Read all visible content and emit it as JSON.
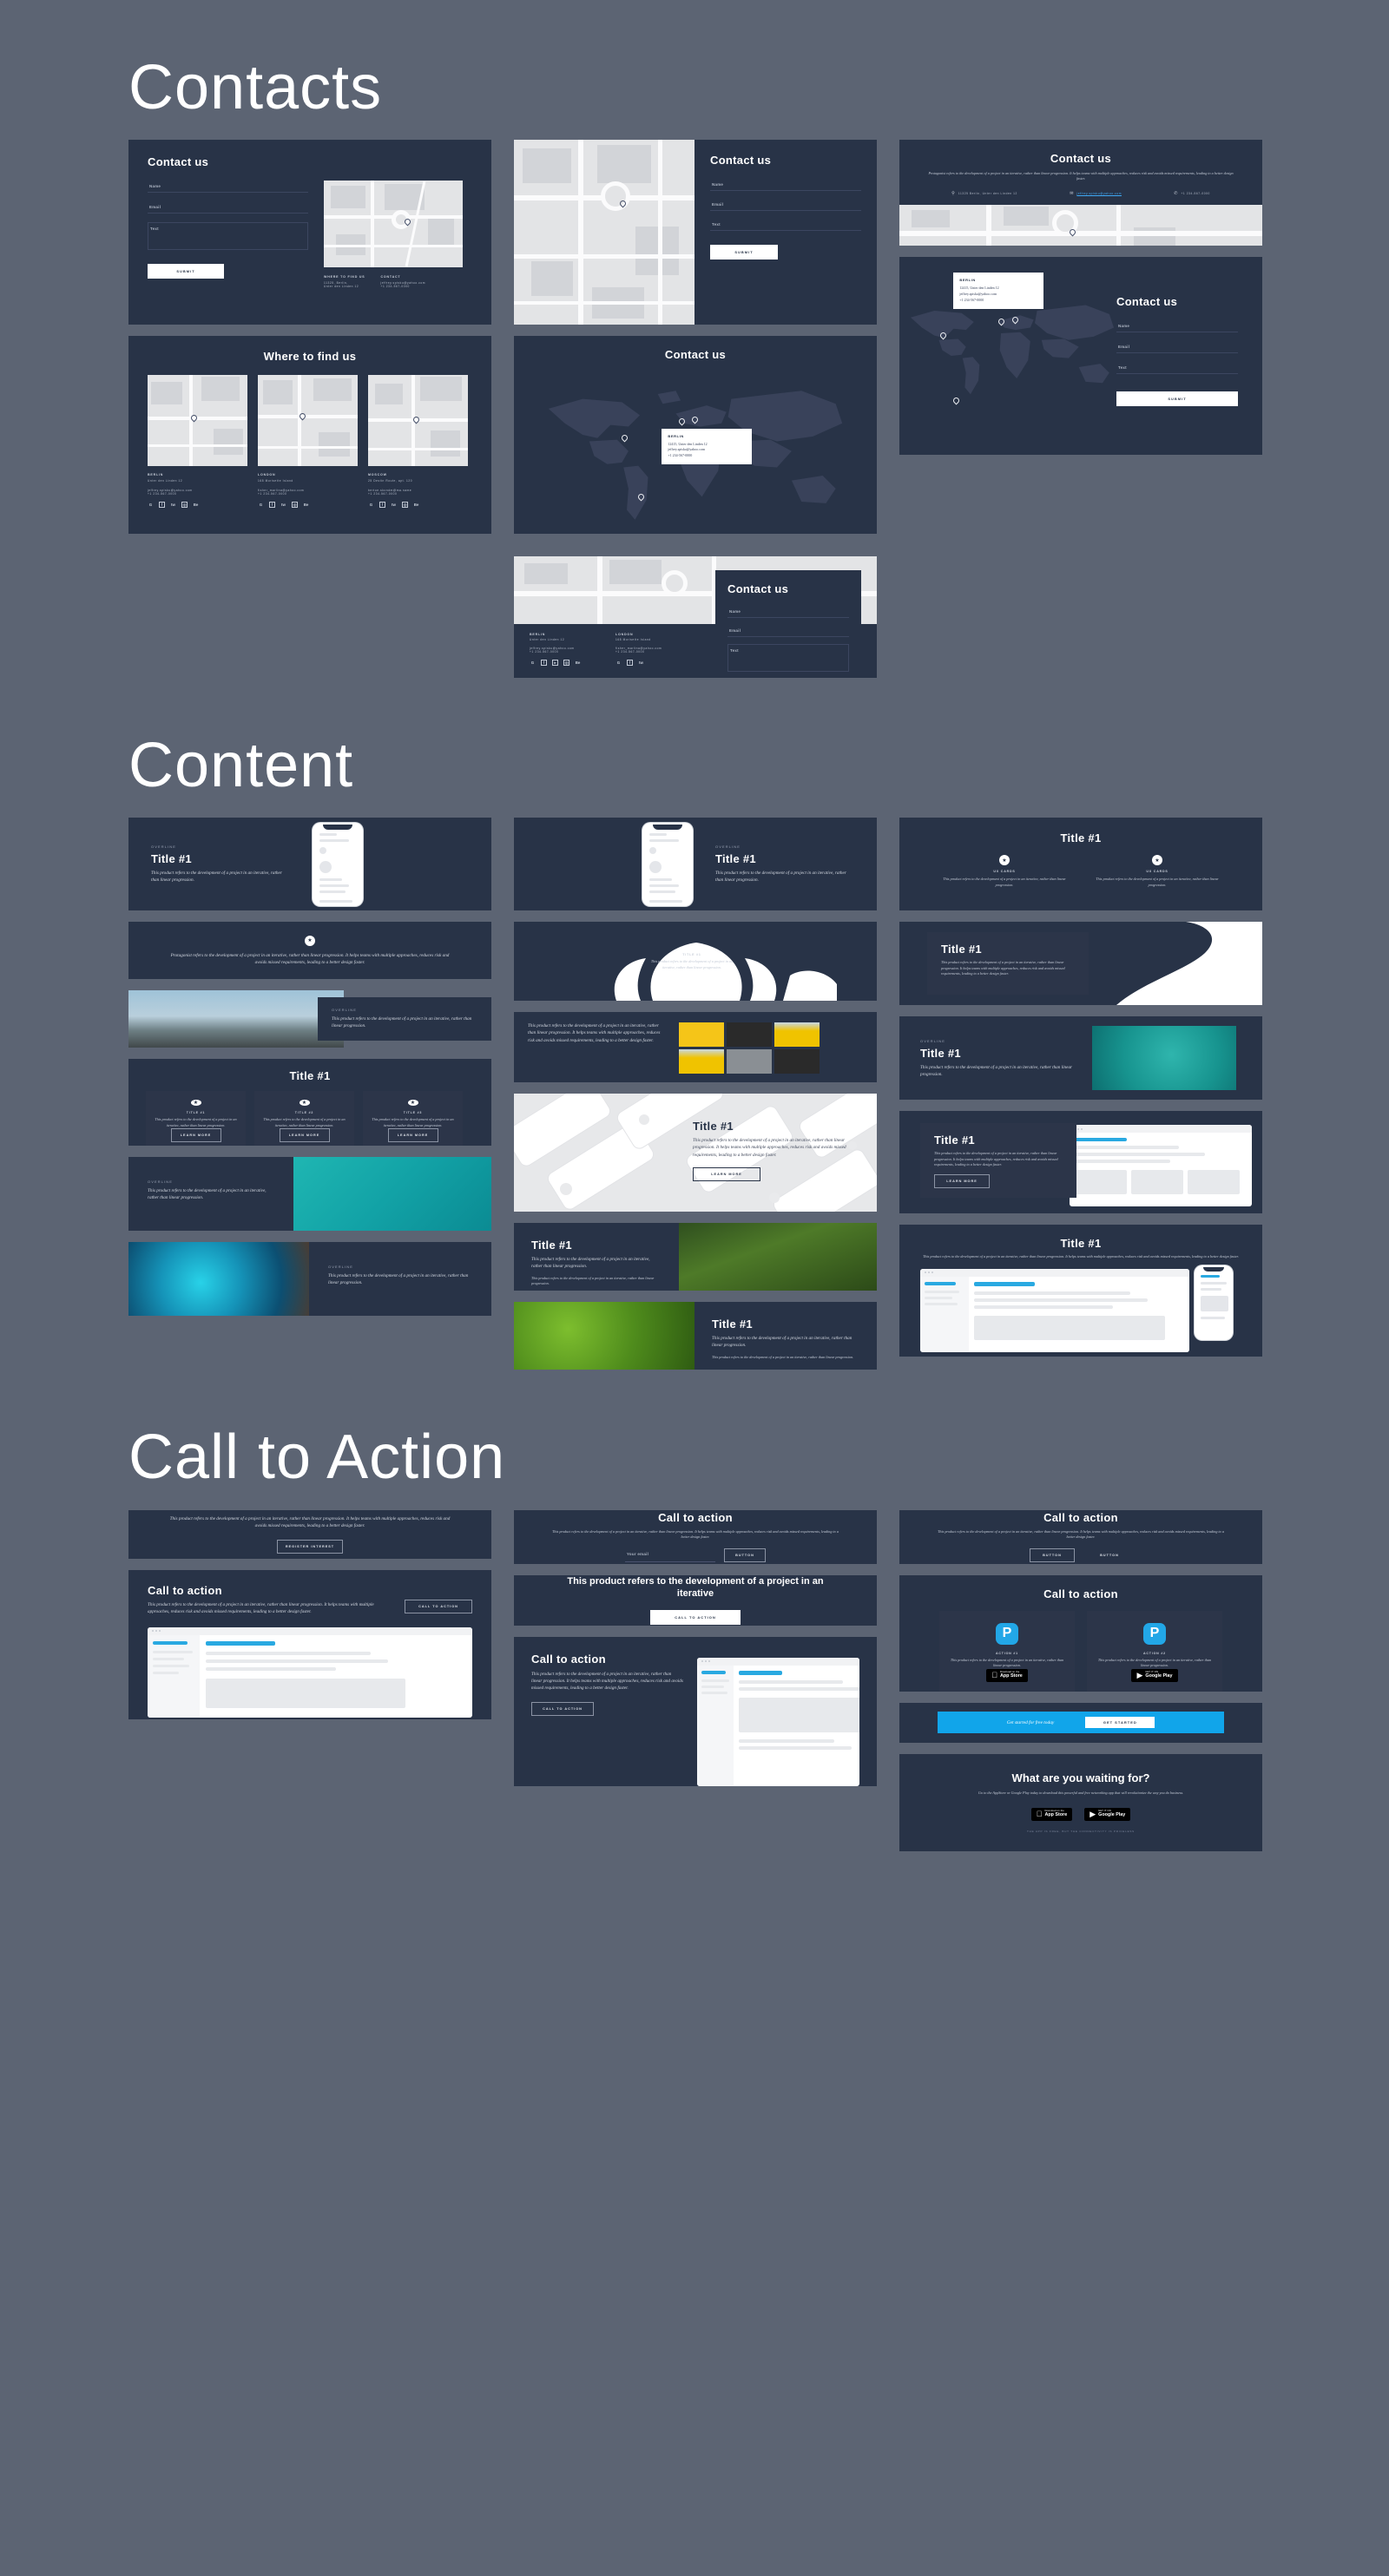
{
  "sections": [
    {
      "id": "contacts",
      "title": "Contacts"
    },
    {
      "id": "content",
      "title": "Content"
    },
    {
      "id": "cta",
      "title": "Call to Action"
    }
  ],
  "common": {
    "heading_contact_us": "Contact us",
    "heading_where_find": "Where to find us",
    "heading_title1": "Title #1",
    "heading_cta": "Call to action",
    "overline": "OVERLINE",
    "paragraph_protagonist": "Protagonist refers to the development of a project in an iterative, rather than linear progression. It helps teams with multiple approaches, reduces risk and avoids missed requirements, leading to a better design faster.",
    "paragraph_product": "This product refers to the development of a project in an iterative, rather than linear progression. It helps teams with multiple approaches, reduces risk and avoids missed requirements, leading to a better design faster.",
    "paragraph_short": "This product refers to the development of a project in an iterative, rather than linear progression.",
    "paragraph_medium": "This product refers to the development of a project in an iterative, rather than linear progression. It helps teams with multiple approaches, reduces risk and avoids missed requirements, leading to a better design faster."
  },
  "form": {
    "name_label": "Name",
    "email_label": "Email",
    "text_label": "Text",
    "submit_label": "SUBMIT"
  },
  "contact_info": {
    "where_label": "WHERE TO FIND US",
    "contact_label": "CONTACT",
    "address": "11325, Berlin,",
    "address2": "Unter den Linden 12",
    "address_inline": "11325 Berlin, Unter den Linden 12",
    "email": "jeffrey.spisku@yahoo.com",
    "phone": "+1 234-567-0000"
  },
  "cities": [
    {
      "name": "BERLIN",
      "address": "Unter den Linden 12",
      "email": "jeffrey.spisku@yahoo.com",
      "phone": "+1 234-567-0000"
    },
    {
      "name": "LONDON",
      "address": "168 Morisette Island",
      "email": "fisher_marlina@yahoo.com",
      "phone": "+1 234-567-0000"
    },
    {
      "name": "MOSCOW",
      "address": "25 Destin Route, apt. 120",
      "email": "bertoe.skondm@ma.name",
      "phone": "+1 234-567-0000"
    }
  ],
  "map_tooltip": {
    "city": "BERLIN",
    "line1": "12415, Unter den Linden 12",
    "line2": "jeffrey.spiska@yahoo.com",
    "line3": "+1 234-567-0000"
  },
  "social_icons": [
    "G",
    "f",
    "tw",
    "ig",
    "be"
  ],
  "content": {
    "cards_3col": [
      {
        "title": "TITLE #1",
        "body": "This product refers to the development of a project in an iterative, rather than linear progression.",
        "button": "LEARN MORE"
      },
      {
        "title": "TITLE #2",
        "body": "This product refers to the development of a project in an iterative, rather than linear progression.",
        "button": "LEARN MORE"
      },
      {
        "title": "TITLE #3",
        "body": "This product refers to the development of a project in an iterative, rather than linear progression.",
        "button": "LEARN MORE"
      }
    ],
    "ux_cards": [
      {
        "title": "UX CARDS",
        "body": "This product refers to the development of a project in an iterative, rather than linear progression."
      },
      {
        "title": "UX CARDS",
        "body": "This product refers to the development of a project in an iterative, rather than linear progression."
      }
    ],
    "wave_caption": "Title #1",
    "learn_more": "LEARN MORE"
  },
  "cta": {
    "register_interest": "REGISTER INTEREST",
    "button_label": "BUTTON",
    "email_placeholder": "Your email",
    "call_to_action_btn": "CALL TO ACTION",
    "banner_heading": "This product refers to the development of a project in an iterative",
    "action_cards": [
      {
        "title": "ACTION #1",
        "body": "This product refers to the development of a project in an iterative, rather than linear progression.",
        "store": "App Store",
        "store_sub": "Download on the"
      },
      {
        "title": "ACTION #2",
        "body": "This product refers to the development of a project in an iterative, rather than linear progression.",
        "store": "Google Play",
        "store_sub": "GET IT ON"
      }
    ],
    "blue_band_text": "Get started for free today",
    "blue_band_button": "GET STARTED",
    "waiting_heading": "What are you waiting for?",
    "waiting_body": "Go to the AppStore or Google Play today to download this powerful and free networking app that will revolutionize the way you do business.",
    "waiting_fineprint": "THE APP IS FREE, BUT THE CONNECTIVITY IS PRICELESS",
    "store_apple_sub": "Download on the",
    "store_apple": "App Store",
    "store_google_sub": "GET IT ON",
    "store_google": "Google Play"
  },
  "colors": {
    "background": "#5c6473",
    "card": "#283347",
    "card_alt": "#2c3549",
    "accent_blue": "#11a5ea",
    "map_light": "#e3e4e6",
    "text_muted": "#9aa3b4"
  }
}
